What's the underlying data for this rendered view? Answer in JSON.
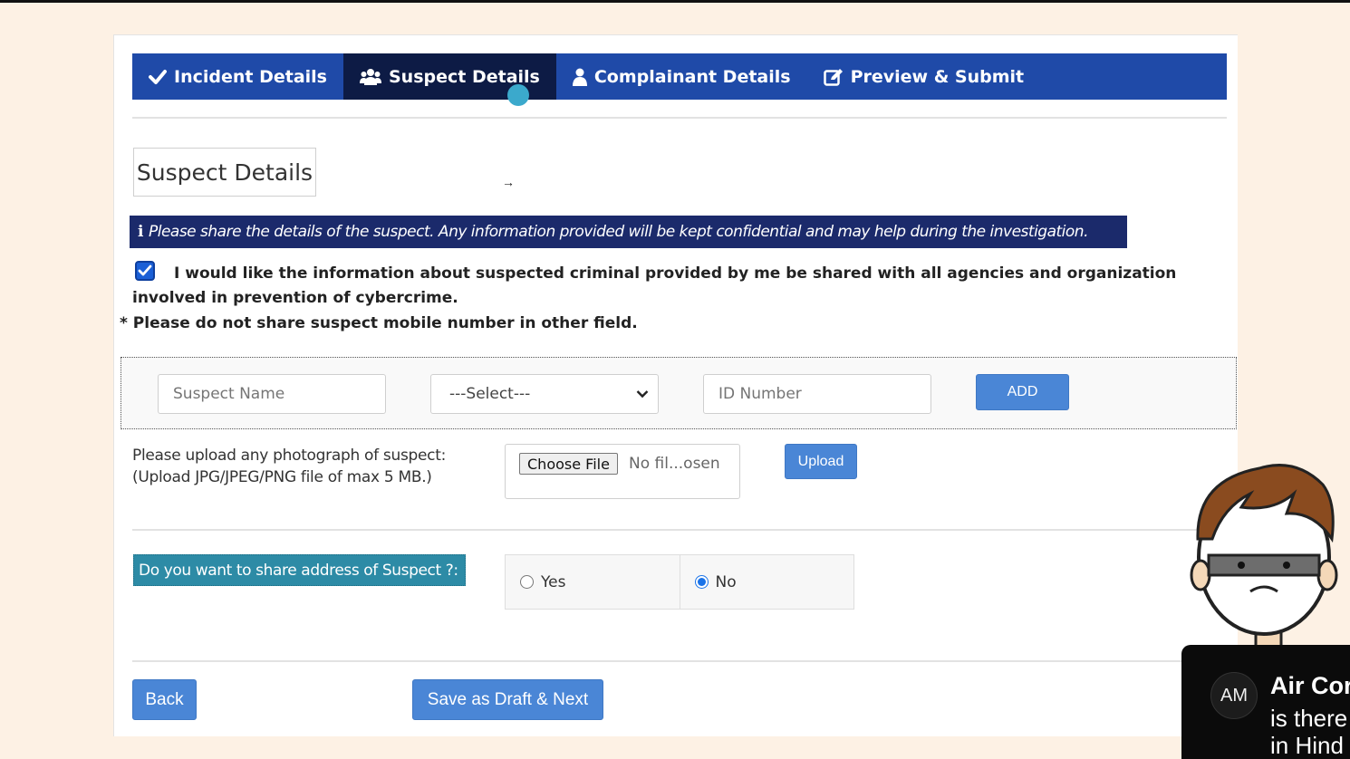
{
  "tabs": [
    {
      "label": "Incident Details",
      "icon": "check-icon"
    },
    {
      "label": "Suspect Details",
      "icon": "users-icon",
      "active": true
    },
    {
      "label": "Complainant Details",
      "icon": "user-icon"
    },
    {
      "label": "Preview & Submit",
      "icon": "edit-icon"
    }
  ],
  "section_title": "Suspect Details",
  "info_banner": "Please share the details of the suspect. Any information provided will be kept confidential and may help during the investigation.",
  "consent_text": "I would like the information about suspected criminal provided by me be shared with all agencies and organization involved in prevention of cybercrime.",
  "consent_checked": true,
  "note_text": "* Please do not share suspect mobile number in other field.",
  "suspect_row": {
    "name_placeholder": "Suspect Name",
    "id_type_selected": "---Select---",
    "id_number_placeholder": "ID Number",
    "add_label": "ADD"
  },
  "upload": {
    "label_line1": "Please upload any photograph of suspect:",
    "label_line2": "(Upload JPG/JPEG/PNG file of max 5 MB.)",
    "choose_label": "Choose File",
    "file_status": "No fil...osen",
    "upload_label": "Upload"
  },
  "address_question": "Do you want to share address of Suspect ?:",
  "address_options": [
    {
      "label": "Yes",
      "selected": false
    },
    {
      "label": "No",
      "selected": true
    }
  ],
  "buttons": {
    "back": "Back",
    "save_next": "Save as Draft & Next"
  },
  "toast": {
    "avatar_initials": "AM",
    "title": "Air Cor",
    "line1": "is there",
    "line2": "in Hind"
  },
  "colors": {
    "tab_bar": "#1f4aa8",
    "tab_active": "#0d1b45",
    "info_banner": "#1b2a6b",
    "button": "#4a86d6",
    "address_label": "#2d8ba6"
  }
}
